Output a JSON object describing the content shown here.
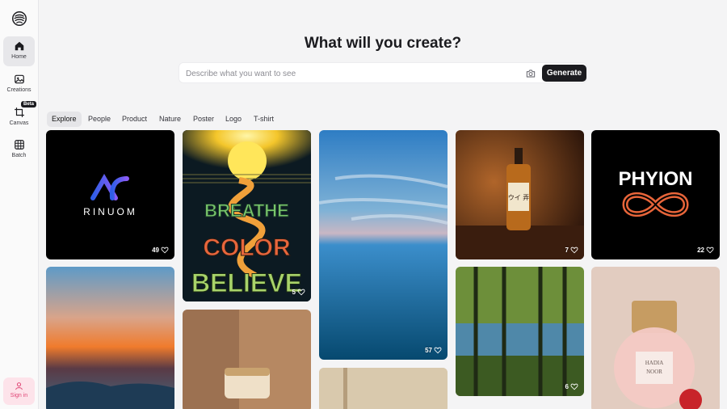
{
  "sidebar": {
    "items": [
      {
        "label": "Home",
        "icon": "home-icon"
      },
      {
        "label": "Creations",
        "icon": "image-icon"
      },
      {
        "label": "Canvas",
        "icon": "canvas-icon",
        "badge": "Beta"
      },
      {
        "label": "Batch",
        "icon": "grid-icon"
      }
    ],
    "signin_label": "Sign in"
  },
  "header": {
    "title": "What will you create?",
    "search_placeholder": "Describe what you want to see",
    "generate_label": "Generate"
  },
  "tabs": [
    "Explore",
    "People",
    "Product",
    "Nature",
    "Poster",
    "Logo",
    "T-shirt"
  ],
  "gallery": {
    "card1": {
      "brand": "RINUOM",
      "likes": "49"
    },
    "card2": {
      "line1": "BREATHE",
      "line2": "COLOR",
      "line3": "BELIEVE",
      "likes": "5"
    },
    "card3": {
      "likes": "57"
    },
    "card4": {
      "label": "ウイ 弄",
      "likes": "7"
    },
    "card5": {
      "brand": "PHYION",
      "likes": "22"
    },
    "card9": {
      "likes": "6"
    },
    "card10": {
      "label1": "HADIA",
      "label2": "NOOR"
    }
  },
  "colors": {
    "accent": "#1b1b1f",
    "signin_pink": "#e04776"
  }
}
